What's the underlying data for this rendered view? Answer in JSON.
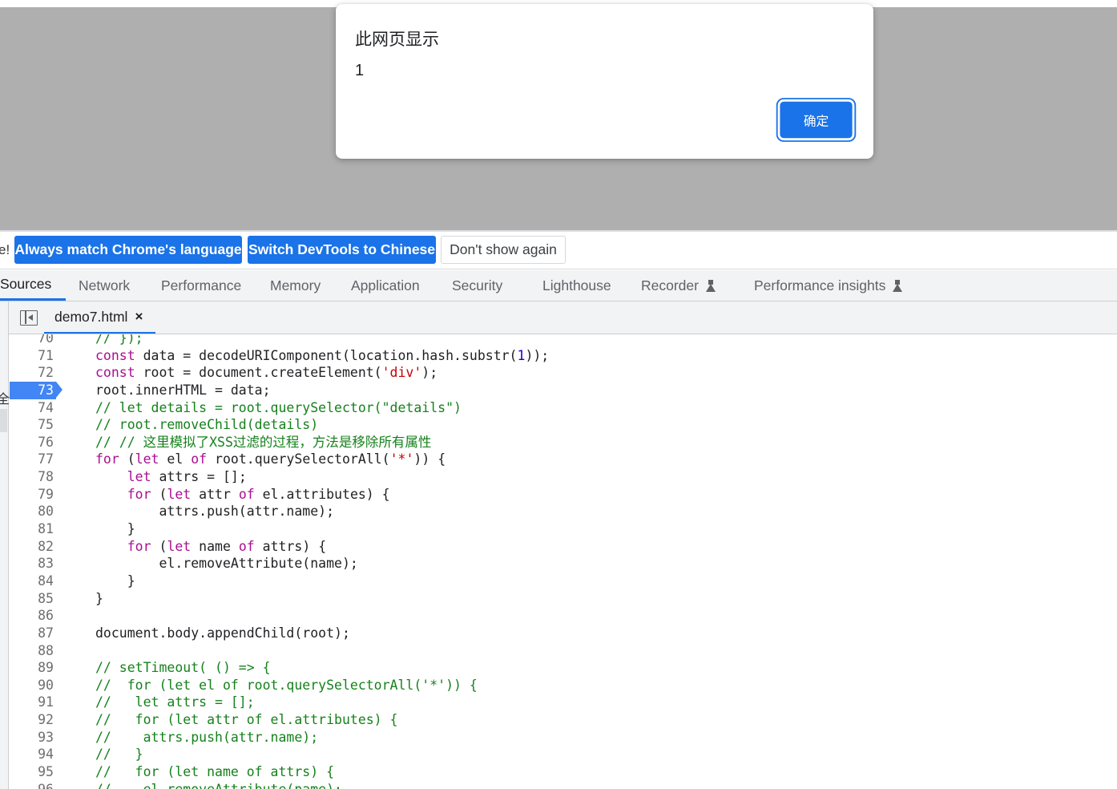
{
  "alert": {
    "title": "此网页显示",
    "message": "1",
    "ok_label": "确定"
  },
  "infobar": {
    "clipped_text": "e!",
    "buttons": [
      {
        "label": "Always match Chrome's language"
      },
      {
        "label": "Switch DevTools to Chinese"
      },
      {
        "label": "Don't show again"
      }
    ]
  },
  "panel_tabs": [
    {
      "label": "Sources",
      "active": true
    },
    {
      "label": "Network"
    },
    {
      "label": "Performance"
    },
    {
      "label": "Memory"
    },
    {
      "label": "Application"
    },
    {
      "label": "Security"
    },
    {
      "label": "Lighthouse"
    },
    {
      "label": "Recorder",
      "icon": "flask-icon"
    },
    {
      "label": "Performance insights",
      "icon": "flask-icon"
    }
  ],
  "file_tab": {
    "name": "demo7.html",
    "close": "×"
  },
  "edge_clip_text": "全",
  "editor": {
    "breakpoint_line": "73",
    "lines": [
      {
        "n": "70",
        "tokens": [
          [
            "cm",
            "// });"
          ]
        ]
      },
      {
        "n": "71",
        "tokens": [
          [
            "kw",
            "const"
          ],
          [
            "",
            " data = decodeURIComponent(location.hash.substr("
          ],
          [
            "num",
            "1"
          ],
          [
            "",
            "));"
          ]
        ]
      },
      {
        "n": "72",
        "tokens": [
          [
            "kw",
            "const"
          ],
          [
            "",
            " root = document.createElement("
          ],
          [
            "str",
            "'div'"
          ],
          [
            "",
            ");"
          ]
        ]
      },
      {
        "n": "73",
        "tokens": [
          [
            "",
            "root.innerHTML = data;"
          ]
        ]
      },
      {
        "n": "74",
        "tokens": [
          [
            "cm",
            "// let details = root.querySelector(\"details\")"
          ]
        ]
      },
      {
        "n": "75",
        "tokens": [
          [
            "cm",
            "// root.removeChild(details)"
          ]
        ]
      },
      {
        "n": "76",
        "tokens": [
          [
            "cm",
            "// // 这里模拟了XSS过滤的过程，方法是移除所有属性"
          ]
        ]
      },
      {
        "n": "77",
        "tokens": [
          [
            "kw",
            "for"
          ],
          [
            "",
            " ("
          ],
          [
            "kw",
            "let"
          ],
          [
            "",
            " el "
          ],
          [
            "kw",
            "of"
          ],
          [
            "",
            " root.querySelectorAll("
          ],
          [
            "str",
            "'*'"
          ],
          [
            "",
            ")) {"
          ]
        ]
      },
      {
        "n": "78",
        "tokens": [
          [
            "",
            "    "
          ],
          [
            "kw",
            "let"
          ],
          [
            "",
            " attrs = [];"
          ]
        ]
      },
      {
        "n": "79",
        "tokens": [
          [
            "",
            "    "
          ],
          [
            "kw",
            "for"
          ],
          [
            "",
            " ("
          ],
          [
            "kw",
            "let"
          ],
          [
            "",
            " attr "
          ],
          [
            "kw",
            "of"
          ],
          [
            "",
            " el.attributes) {"
          ]
        ]
      },
      {
        "n": "80",
        "tokens": [
          [
            "",
            "        attrs.push(attr.name);"
          ]
        ]
      },
      {
        "n": "81",
        "tokens": [
          [
            "",
            "    }"
          ]
        ]
      },
      {
        "n": "82",
        "tokens": [
          [
            "",
            "    "
          ],
          [
            "kw",
            "for"
          ],
          [
            "",
            " ("
          ],
          [
            "kw",
            "let"
          ],
          [
            "",
            " name "
          ],
          [
            "kw",
            "of"
          ],
          [
            "",
            " attrs) {"
          ]
        ]
      },
      {
        "n": "83",
        "tokens": [
          [
            "",
            "        el.removeAttribute(name);"
          ]
        ]
      },
      {
        "n": "84",
        "tokens": [
          [
            "",
            "    }"
          ]
        ]
      },
      {
        "n": "85",
        "tokens": [
          [
            "",
            "}"
          ]
        ]
      },
      {
        "n": "86",
        "tokens": [
          [
            "",
            ""
          ]
        ]
      },
      {
        "n": "87",
        "tokens": [
          [
            "",
            "document.body.appendChild(root);"
          ]
        ]
      },
      {
        "n": "88",
        "tokens": [
          [
            "",
            ""
          ]
        ]
      },
      {
        "n": "89",
        "tokens": [
          [
            "cm",
            "// setTimeout( () => {"
          ]
        ]
      },
      {
        "n": "90",
        "tokens": [
          [
            "cm",
            "//  for (let el of root.querySelectorAll('*')) {"
          ]
        ]
      },
      {
        "n": "91",
        "tokens": [
          [
            "cm",
            "//   let attrs = [];"
          ]
        ]
      },
      {
        "n": "92",
        "tokens": [
          [
            "cm",
            "//   for (let attr of el.attributes) {"
          ]
        ]
      },
      {
        "n": "93",
        "tokens": [
          [
            "cm",
            "//    attrs.push(attr.name);"
          ]
        ]
      },
      {
        "n": "94",
        "tokens": [
          [
            "cm",
            "//   }"
          ]
        ]
      },
      {
        "n": "95",
        "tokens": [
          [
            "cm",
            "//   for (let name of attrs) {"
          ]
        ]
      },
      {
        "n": "96",
        "tokens": [
          [
            "cm",
            "//    el.removeAttribute(name);"
          ]
        ]
      }
    ]
  }
}
